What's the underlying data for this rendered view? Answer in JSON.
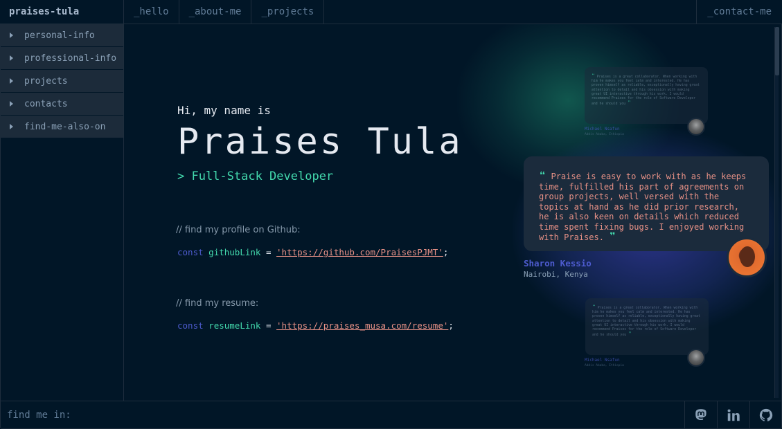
{
  "header": {
    "brand": "praises-tula",
    "tabs": [
      "_hello",
      "_about-me",
      "_projects"
    ],
    "contact": "_contact-me"
  },
  "sidebar": {
    "items": [
      "personal-info",
      "professional-info",
      "projects",
      "contacts",
      "find-me-also-on"
    ]
  },
  "hero": {
    "greeting": "Hi, my name is",
    "name": "Praises Tula",
    "role": "> Full-Stack Developer"
  },
  "code": {
    "comment1": "// find my profile on Github:",
    "line1": {
      "keyword": "const",
      "variable": "githubLink",
      "op": "=",
      "value": "'https://github.com/PraisesPJMT'",
      "end": ";"
    },
    "comment2": "// find my resume:",
    "line2": {
      "keyword": "const",
      "variable": "resumeLink",
      "op": "=",
      "value": "'https://praises_musa.com/resume'",
      "end": ";"
    }
  },
  "testimonials": {
    "faded_text": "Praises is a great collaborator. When working with him he makes you feel calm and interested. He has proven himself as reliable, exceptionally having great attention to detail and his obsession with making great UI interactive through his work. I would recommend Praises for the role of Software Developer and he should you",
    "faded_name": "Michael Nsafun",
    "faded_location": "Addis Ababa, Ethiopia",
    "main_quote": "Praise is easy to work with as he keeps time, fulfilled his part of agreements on group projects, well versed with the topics at hand as he did prior research, he is also keen on details which reduced time spent fixing bugs. I enjoyed working with Praises.",
    "main_name": "Sharon Kessio",
    "main_location": "Nairobi, Kenya"
  },
  "footer": {
    "label": "find me in:",
    "socials": [
      "mastodon-icon",
      "linkedin-icon",
      "github-icon"
    ]
  },
  "colors": {
    "background": "#011627",
    "accent_green": "#43d9ad",
    "accent_blue": "#4d5bce",
    "string": "#e99287",
    "border": "#1e2d3d"
  }
}
